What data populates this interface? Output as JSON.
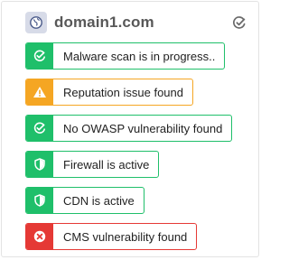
{
  "header": {
    "domain": "domain1.com",
    "favicon_icon": "globe-icon",
    "edit_icon": "edit-check-icon"
  },
  "colors": {
    "success": "#1fbf6a",
    "warning": "#f5a623",
    "danger": "#e53935",
    "title": "#585858"
  },
  "statuses": [
    {
      "label": "Malware scan is in progress..",
      "status": "success",
      "icon": "check-circle-icon"
    },
    {
      "label": "Reputation issue found",
      "status": "warning",
      "icon": "warning-triangle-icon"
    },
    {
      "label": "No OWASP vulnerability found",
      "status": "success",
      "icon": "check-circle-icon"
    },
    {
      "label": "Firewall is active",
      "status": "success",
      "icon": "shield-icon"
    },
    {
      "label": "CDN is active",
      "status": "success",
      "icon": "shield-icon"
    },
    {
      "label": "CMS vulnerability found",
      "status": "danger",
      "icon": "x-circle-icon"
    }
  ]
}
